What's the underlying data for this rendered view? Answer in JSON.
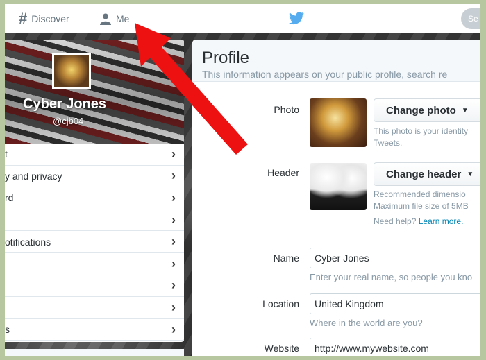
{
  "topnav": {
    "discover_label": "Discover",
    "me_label": "Me",
    "search_label": "Se"
  },
  "profile_card": {
    "name": "Cyber Jones",
    "handle": "@cjb04"
  },
  "settings_menu": {
    "items": [
      {
        "label": "t"
      },
      {
        "label": "y and privacy"
      },
      {
        "label": "rd"
      },
      {
        "label": ""
      },
      {
        "label": "otifications"
      },
      {
        "label": ""
      },
      {
        "label": ""
      },
      {
        "label": ""
      },
      {
        "label": "s"
      }
    ]
  },
  "profile_panel": {
    "title": "Profile",
    "subtitle": "This information appears on your public profile, search re",
    "photo_label": "Photo",
    "change_photo_label": "Change photo",
    "photo_help_line1": "This photo is your identity",
    "photo_help_line2": "Tweets.",
    "header_label": "Header",
    "change_header_label": "Change header",
    "header_help_line1": "Recommended dimensio",
    "header_help_line2": "Maximum file size of 5MB",
    "need_help_text": "Need help?",
    "learn_more_text": "Learn more.",
    "name_label": "Name",
    "name_value": "Cyber Jones",
    "name_help": "Enter your real name, so people you kno",
    "location_label": "Location",
    "location_value": "United Kingdom",
    "location_help": "Where in the world are you?",
    "website_label": "Website",
    "website_value": "http://www.mywebsite.com"
  },
  "colors": {
    "accent_link": "#0084b4",
    "twitter_blue": "#55acee",
    "arrow_red": "#ee1111"
  }
}
